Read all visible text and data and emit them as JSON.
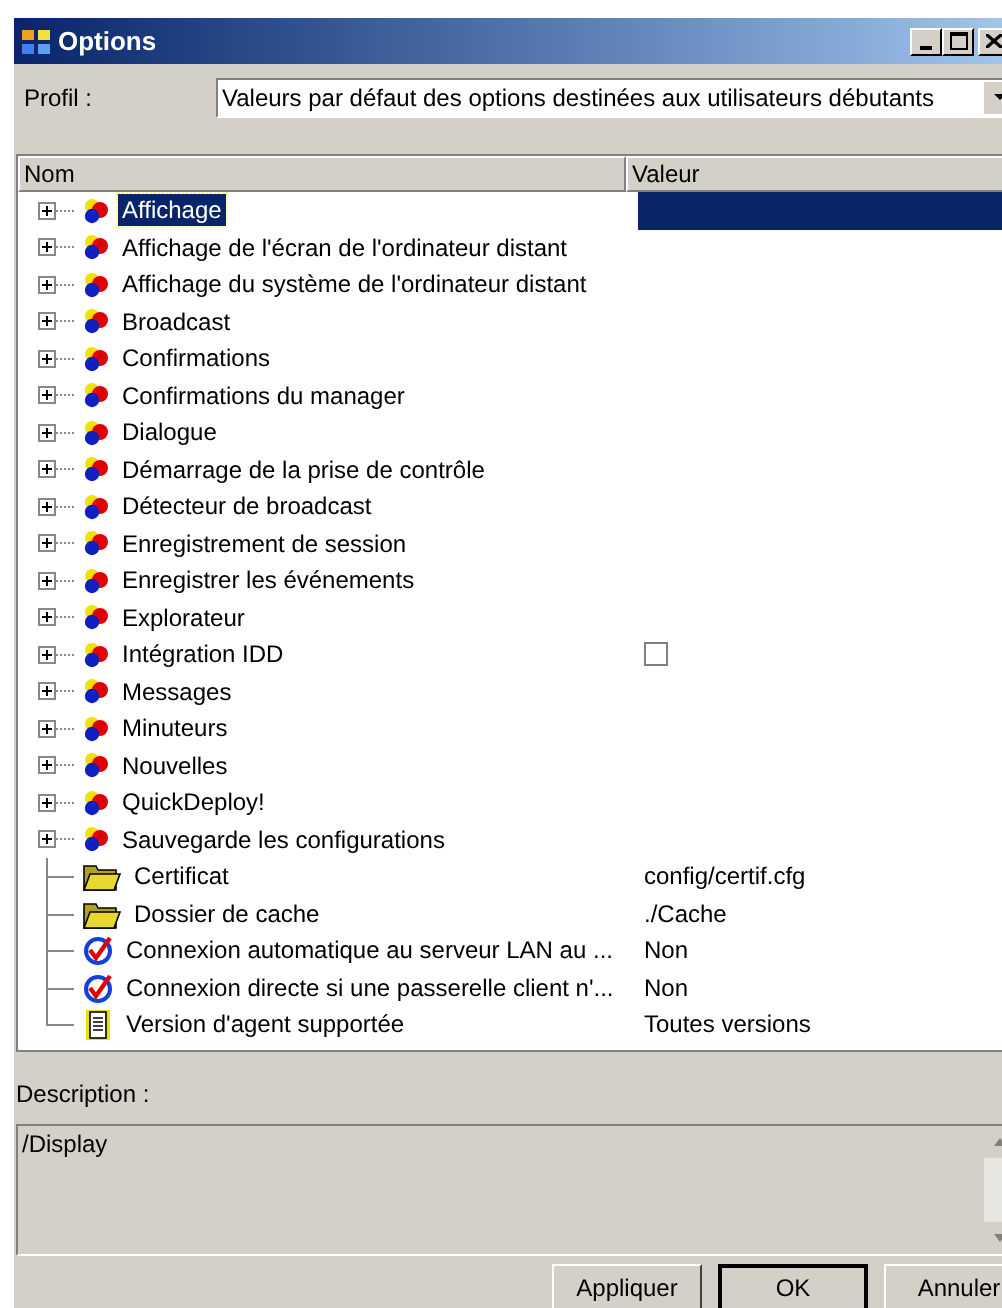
{
  "window": {
    "title": "Options"
  },
  "profile": {
    "label": "Profil :",
    "value": "Valeurs par défaut des options destinées aux utilisateurs débutants"
  },
  "table": {
    "columns": [
      "Nom",
      "Valeur"
    ],
    "rows": [
      {
        "label": "Affichage",
        "kind": "group",
        "selected": true
      },
      {
        "label": "Affichage de l'écran de l'ordinateur distant",
        "kind": "group",
        "selected": false
      },
      {
        "label": "Affichage du système de l'ordinateur distant",
        "kind": "group",
        "selected": false
      },
      {
        "label": "Broadcast",
        "kind": "group",
        "selected": false
      },
      {
        "label": "Confirmations",
        "kind": "group",
        "selected": false
      },
      {
        "label": "Confirmations du manager",
        "kind": "group",
        "selected": false
      },
      {
        "label": "Dialogue",
        "kind": "group",
        "selected": false
      },
      {
        "label": "Démarrage de la prise de contrôle",
        "kind": "group",
        "selected": false
      },
      {
        "label": "Détecteur de broadcast",
        "kind": "group",
        "selected": false
      },
      {
        "label": "Enregistrement de session",
        "kind": "group",
        "selected": false
      },
      {
        "label": "Enregistrer les événements",
        "kind": "group",
        "selected": false
      },
      {
        "label": "Explorateur",
        "kind": "group",
        "selected": false
      },
      {
        "label": "Intégration IDD",
        "kind": "group",
        "selected": false,
        "checked": false
      },
      {
        "label": "Messages",
        "kind": "group",
        "selected": false
      },
      {
        "label": "Minuteurs",
        "kind": "group",
        "selected": false
      },
      {
        "label": "Nouvelles",
        "kind": "group",
        "selected": false
      },
      {
        "label": "QuickDeploy!",
        "kind": "group",
        "selected": false
      },
      {
        "label": "Sauvegarde les configurations",
        "kind": "group",
        "selected": false
      },
      {
        "label": "Certificat",
        "kind": "path",
        "selected": false,
        "value": "config/certif.cfg"
      },
      {
        "label": "Dossier de cache",
        "kind": "path",
        "selected": false,
        "value": "./Cache"
      },
      {
        "label": "Connexion automatique au serveur LAN au ...",
        "kind": "boolean",
        "selected": false,
        "value": "Non"
      },
      {
        "label": "Connexion directe si une passerelle client n'...",
        "kind": "boolean",
        "selected": false,
        "value": "Non"
      },
      {
        "label": "Version d'agent supportée",
        "kind": "version",
        "selected": false,
        "value": "Toutes versions"
      }
    ]
  },
  "description": {
    "label": "Description :",
    "text": "/Display"
  },
  "buttons": [
    {
      "label": "Appliquer",
      "default": false
    },
    {
      "label": "OK",
      "default": true
    },
    {
      "label": "Annuler",
      "default": false
    }
  ]
}
